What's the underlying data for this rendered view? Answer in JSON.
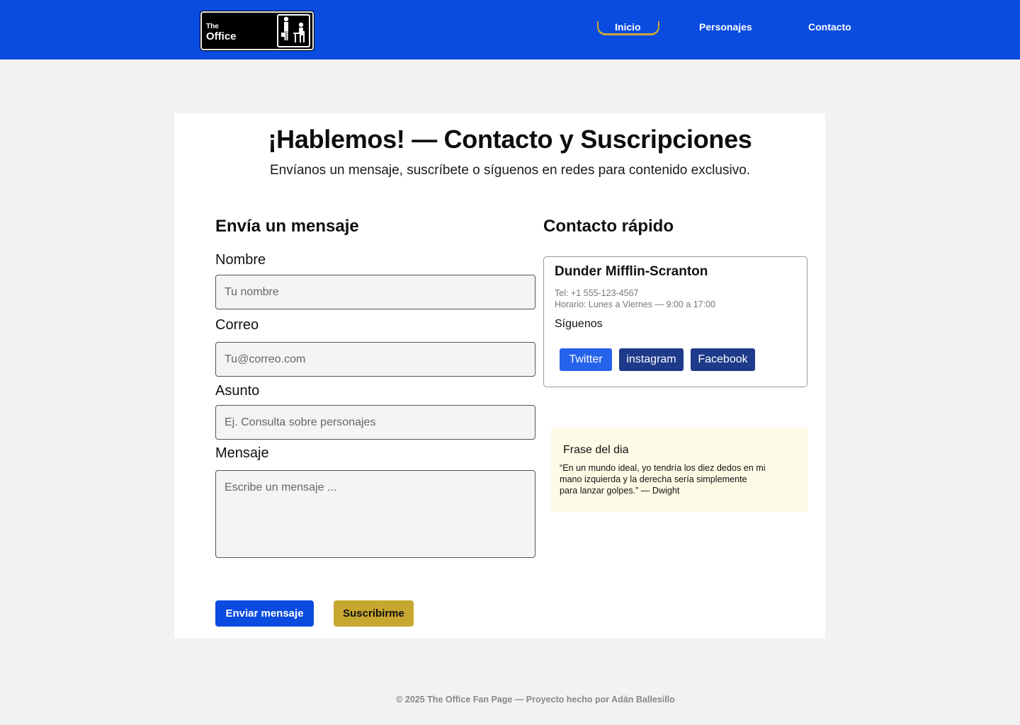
{
  "logo": {
    "line1": "The",
    "line2": "Office"
  },
  "nav": {
    "items": [
      {
        "label": "Inicio",
        "active": true
      },
      {
        "label": "Personajes",
        "active": false
      },
      {
        "label": "Contacto",
        "active": false
      }
    ]
  },
  "hero": {
    "title": "¡Hablemos! — Contacto y Suscripciones",
    "subtitle": "Envíanos un mensaje, suscríbete o síguenos en redes para contenido exclusivo."
  },
  "form": {
    "heading": "Envía un mensaje",
    "name_label": "Nombre",
    "name_placeholder": "Tu nombre",
    "email_label": "Correo",
    "email_placeholder": "Tu@correo.com",
    "subject_label": "Asunto",
    "subject_placeholder": "Ej. Consulta sobre personajes",
    "message_label": "Mensaje",
    "message_placeholder": "Escribe un mensaje ...",
    "send_label": "Enviar mensaje",
    "subscribe_label": "Suscribirme"
  },
  "quick": {
    "heading": "Contacto rápido",
    "company": "Dunder Mifflin-Scranton",
    "phone": "Tel: +1 555-123-4567",
    "hours": "Horario: Lunes a Viernes — 9:00 a 17:00",
    "follow": "Síguenos",
    "socials": [
      {
        "label": "Twitter",
        "color": "#2563eb"
      },
      {
        "label": "instagram",
        "color": "#1e3a8a"
      },
      {
        "label": "Facebook",
        "color": "#1e3a8a"
      }
    ]
  },
  "quote": {
    "title": "Frase del dia",
    "line1": "“En un mundo ideal, yo tendría los diez dedos en mi",
    "line2": "mano izquierda y la derecha sería simplemente",
    "line3": "para lanzar golpes.” —  Dwight"
  },
  "footer": {
    "text": "© 2025 The Office Fan Page — Proyecto hecho por Adán Ballesillo"
  },
  "colors": {
    "brand": "#0a4be0",
    "accent": "#c8a731",
    "quote_bg": "#fdfbe6"
  }
}
